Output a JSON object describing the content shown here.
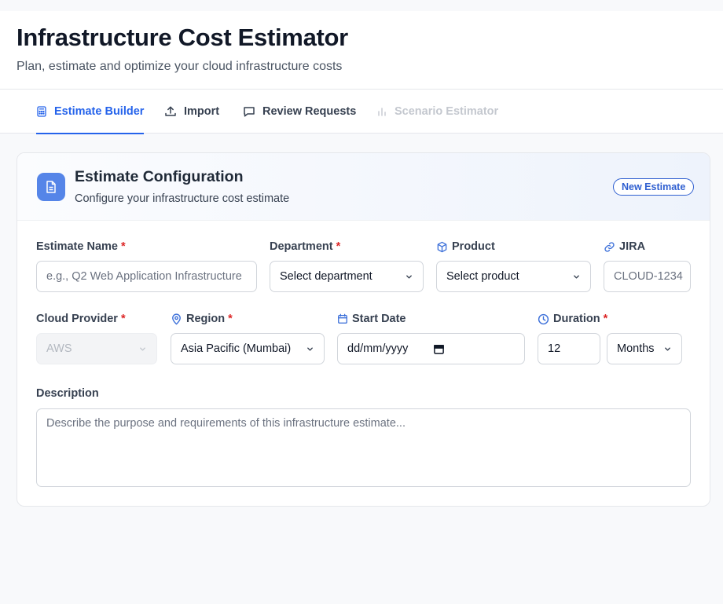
{
  "header": {
    "title": "Infrastructure Cost Estimator",
    "subtitle": "Plan, estimate and optimize your cloud infrastructure costs"
  },
  "tabs": [
    {
      "label": "Estimate Builder",
      "icon": "calculator-icon",
      "state": "active"
    },
    {
      "label": "Import",
      "icon": "upload-icon",
      "state": "normal"
    },
    {
      "label": "Review Requests",
      "icon": "message-icon",
      "state": "normal"
    },
    {
      "label": "Scenario Estimator",
      "icon": "bar-chart-icon",
      "state": "disabled"
    }
  ],
  "card": {
    "title": "Estimate Configuration",
    "subtitle": "Configure your infrastructure cost estimate",
    "badge": "New Estimate",
    "icon": "document-icon"
  },
  "form": {
    "estimate_name": {
      "label": "Estimate Name",
      "required": "*",
      "placeholder": "e.g., Q2 Web Application Infrastructure"
    },
    "department": {
      "label": "Department",
      "required": "*",
      "value": "Select department"
    },
    "product": {
      "label": "Product",
      "value": "Select product",
      "icon": "box-icon"
    },
    "jira": {
      "label": "JIRA",
      "placeholder": "CLOUD-1234",
      "icon": "link-icon"
    },
    "cloud_provider": {
      "label": "Cloud Provider",
      "required": "*",
      "value": "AWS"
    },
    "region": {
      "label": "Region",
      "required": "*",
      "value": "Asia Pacific (Mumbai)",
      "icon": "map-pin-icon"
    },
    "start_date": {
      "label": "Start Date",
      "value": "dd/mm/yyyy",
      "icon": "calendar-icon"
    },
    "duration": {
      "label": "Duration",
      "required": "*",
      "value": "12",
      "unit": "Months",
      "icon": "clock-icon"
    },
    "description": {
      "label": "Description",
      "placeholder": "Describe the purpose and requirements of this infrastructure estimate..."
    }
  },
  "colors": {
    "accent": "#2563eb",
    "required": "#dc2626",
    "icon_bg": "#5585e8"
  }
}
